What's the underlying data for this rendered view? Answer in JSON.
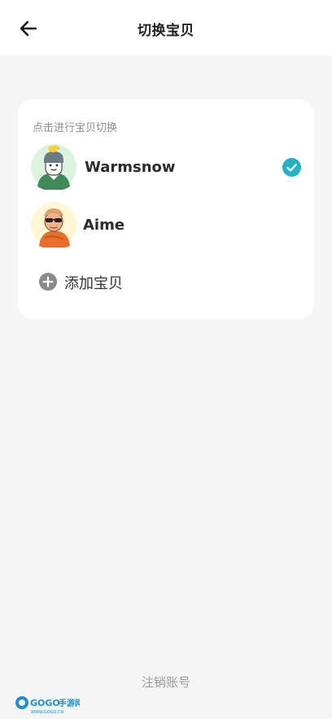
{
  "header": {
    "title": "切换宝贝",
    "back_icon": "arrow-left-icon"
  },
  "card": {
    "hint": "点击进行宝贝切换",
    "babies": [
      {
        "name": "Warmsnow",
        "selected": true,
        "avatar": "boy-with-chick-avatar"
      },
      {
        "name": "Aime",
        "selected": false,
        "avatar": "sunglasses-avatar"
      }
    ],
    "add_label": "添加宝贝",
    "add_icon": "plus-circle-icon",
    "check_icon": "check-circle-icon"
  },
  "footer": {
    "logout_label": "注销账号"
  },
  "watermark": {
    "text": "GOGO手游网",
    "sub": "WWW.GOGO.CN"
  },
  "colors": {
    "accent": "#21b3c4",
    "page_bg": "#f5f5f5",
    "card_bg": "#ffffff"
  }
}
